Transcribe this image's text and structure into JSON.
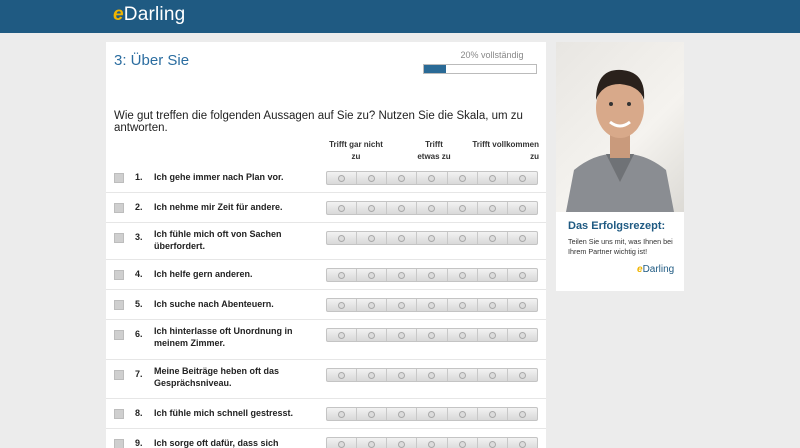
{
  "header": {
    "logo_text": "Darling",
    "logo_prefix": "e"
  },
  "survey": {
    "section_title": "3: Über Sie",
    "progress_label": "20% vollständig",
    "progress": 0.2,
    "question": "Wie gut treffen die folgenden Aussagen auf Sie zu? Nutzen Sie die Skala, um zu antworten.",
    "scale_labels": {
      "low": "Trifft gar nicht zu",
      "mid_1": "Trifft",
      "mid_2": "etwas zu",
      "high_1": "Trifft vollkommen",
      "high_2": "zu"
    },
    "items": [
      {
        "num": "1.",
        "text": "Ich gehe immer nach Plan vor."
      },
      {
        "num": "2.",
        "text": "Ich nehme mir Zeit für andere."
      },
      {
        "num": "3.",
        "text": "Ich fühle mich oft von Sachen überfordert."
      },
      {
        "num": "4.",
        "text": "Ich helfe gern anderen."
      },
      {
        "num": "5.",
        "text": "Ich suche nach Abenteuern."
      },
      {
        "num": "6.",
        "text": "Ich hinterlasse oft Unordnung in meinem Zimmer."
      },
      {
        "num": "7.",
        "text": "Meine Beiträge heben oft das Gesprächsniveau."
      },
      {
        "num": "8.",
        "text": "Ich fühle mich schnell gestresst."
      },
      {
        "num": "9.",
        "text": "Ich sorge oft dafür, dass sich andere"
      }
    ]
  },
  "sidebar": {
    "promo_title": "Das Erfolgsrezept:",
    "promo_text": "Teilen Sie uns mit, was Ihnen bei Ihrem Partner wichtig ist!",
    "logo_text": "Darling",
    "logo_prefix": "e"
  },
  "colors": {
    "header": "#1f5a82",
    "accent": "#f0b400",
    "progress_fill": "#2a6a96"
  }
}
